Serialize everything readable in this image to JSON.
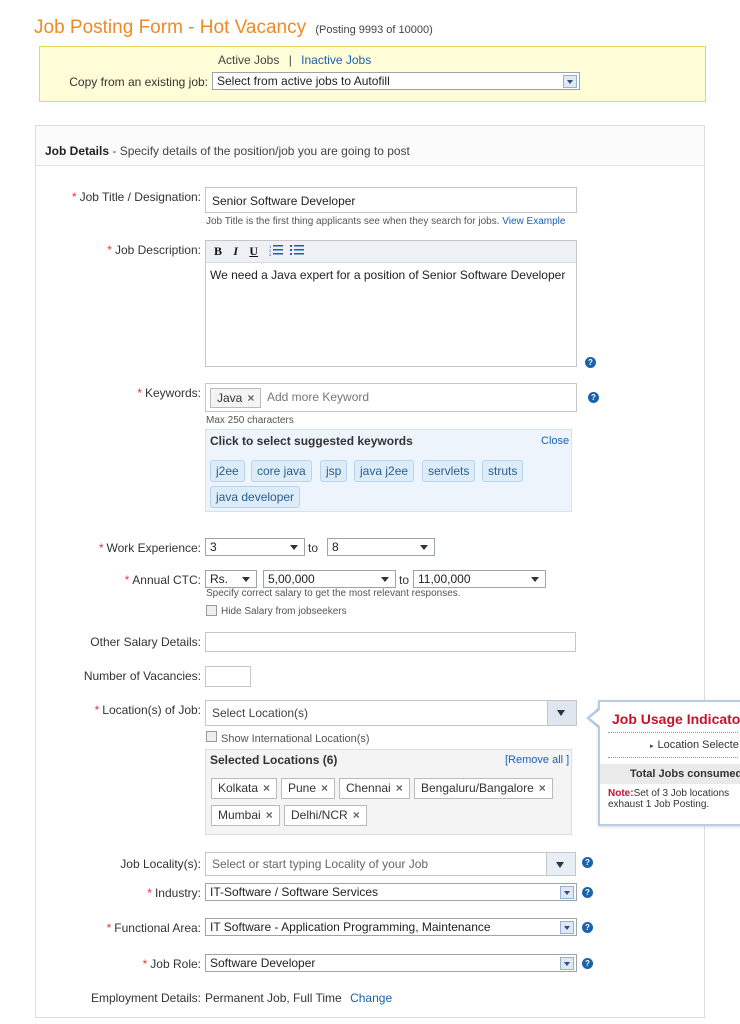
{
  "header": {
    "title": "Job Posting Form - Hot Vacancy",
    "posting_count": "(Posting 9993 of 10000)"
  },
  "copy_section": {
    "active_tab": "Active Jobs",
    "separator": "|",
    "inactive_tab": "Inactive Jobs",
    "copy_label": "Copy from an existing job:",
    "copy_select_value": "Select from active jobs to Autofill"
  },
  "job_details": {
    "heading": "Job Details",
    "subheading": "- Specify details of the position/job you are going to post",
    "required_mark": "*",
    "job_title": {
      "label": "Job Title / Designation:",
      "value": "Senior Software Developer",
      "hint": "Job Title is the first thing applicants see when they search for jobs.",
      "hint_link": "View Example"
    },
    "job_description": {
      "label": "Job Description:",
      "value": "We need a Java expert for a position of Senior Software Developer",
      "toolbar": {
        "bold": "B",
        "italic": "I",
        "underline": "U"
      }
    },
    "keywords": {
      "label": "Keywords:",
      "tags": [
        "Java"
      ],
      "placeholder": "Add more Keyword",
      "hint": "Max 250 characters",
      "suggest_title": "Click to select suggested keywords",
      "close_label": "Close",
      "suggested": [
        "j2ee",
        "core java",
        "jsp",
        "java j2ee",
        "servlets",
        "struts",
        "java developer"
      ]
    },
    "experience": {
      "label": "Work Experience:",
      "from": "3",
      "to_label": "to",
      "to": "8"
    },
    "ctc": {
      "label": "Annual CTC:",
      "currency": "Rs.",
      "from": "5,00,000",
      "to_label": "to",
      "to": "11,00,000",
      "hint": "Specify correct salary to get the most relevant responses.",
      "hide_label": "Hide Salary from jobseekers"
    },
    "other_salary": {
      "label": "Other Salary Details:",
      "value": ""
    },
    "vacancies": {
      "label": "Number of Vacancies:",
      "value": ""
    },
    "locations": {
      "label": "Location(s) of Job:",
      "placeholder": "Select Location(s)",
      "intl_label": "Show International Location(s)",
      "selected_title": "Selected Locations (6)",
      "remove_all": "[Remove all ]",
      "items": [
        "Kolkata",
        "Pune",
        "Chennai",
        "Bengaluru/Bangalore",
        "Mumbai",
        "Delhi/NCR"
      ]
    },
    "locality": {
      "label": "Job Locality(s):",
      "placeholder": "Select or start typing Locality of your Job"
    },
    "industry": {
      "label": "Industry:",
      "value": "IT-Software / Software Services"
    },
    "functional_area": {
      "label": "Functional Area:",
      "value": "IT Software - Application Programming, Maintenance"
    },
    "job_role": {
      "label": "Job Role:",
      "value": "Software Developer"
    },
    "employment": {
      "label": "Employment Details:",
      "value": "Permanent Job, Full Time",
      "change_label": "Change"
    }
  },
  "usage_indicator": {
    "title": "Job Usage Indicato",
    "location_selected": "Location Selecte",
    "total_consumed": "Total Jobs consumed",
    "note_prefix": "Note:",
    "note_text": "Set of 3 Job locations",
    "note_text2": "exhaust 1 Job Posting."
  },
  "close_x": "×",
  "help_glyph": "?"
}
